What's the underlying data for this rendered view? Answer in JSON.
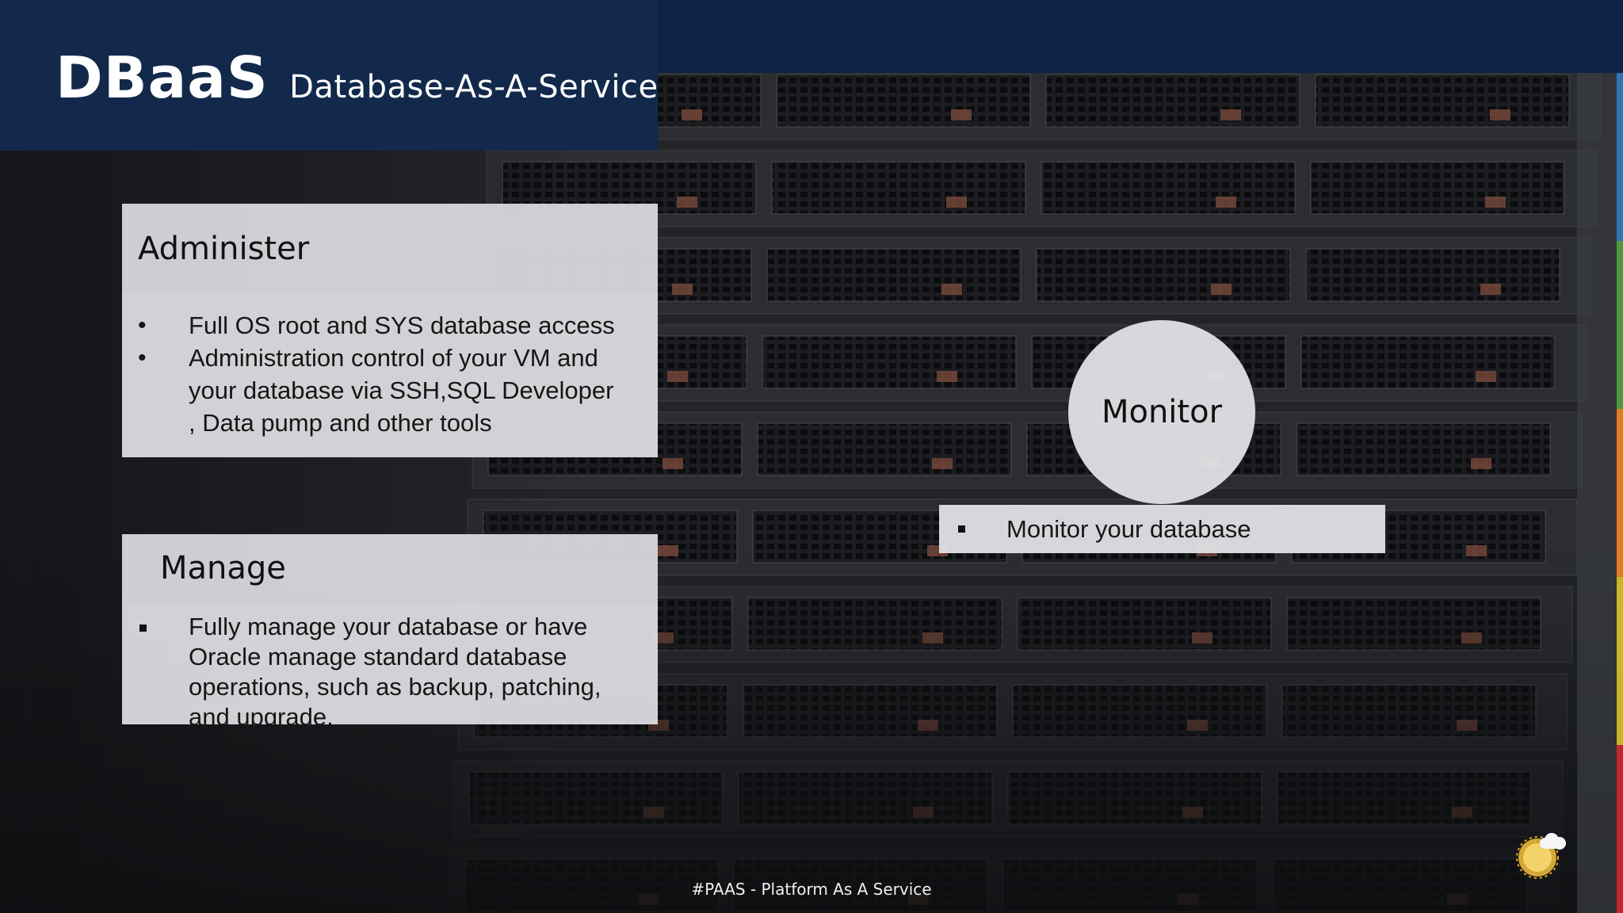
{
  "header": {
    "title": "DBaaS",
    "subtitle": "Database-As-A-Service"
  },
  "administer": {
    "heading": "Administer",
    "bullet_glyph": "•",
    "items": [
      "Full OS root and SYS database access",
      "Administration control of your VM and your database via SSH,SQL  Developer , Data pump and other tools"
    ]
  },
  "manage": {
    "heading": "Manage",
    "items": [
      "Fully manage your database or have  Oracle manage standard database operations, such as backup, patching, and upgrade."
    ]
  },
  "monitor": {
    "heading": "Monitor",
    "items": [
      "Monitor your database"
    ]
  },
  "footer": {
    "text": "#PAAS - Platform As A Service"
  },
  "colors": {
    "header_band": "#13294b",
    "header_top": "#0f2444",
    "panel": "#e0e0e4",
    "panel_head": "#cdcdd2",
    "strip": [
      "#2e75b6",
      "#4c9a3a",
      "#e07b22",
      "#c9b526",
      "#c0282d"
    ]
  },
  "icons": {
    "logo": "sun-cloud-icon"
  }
}
